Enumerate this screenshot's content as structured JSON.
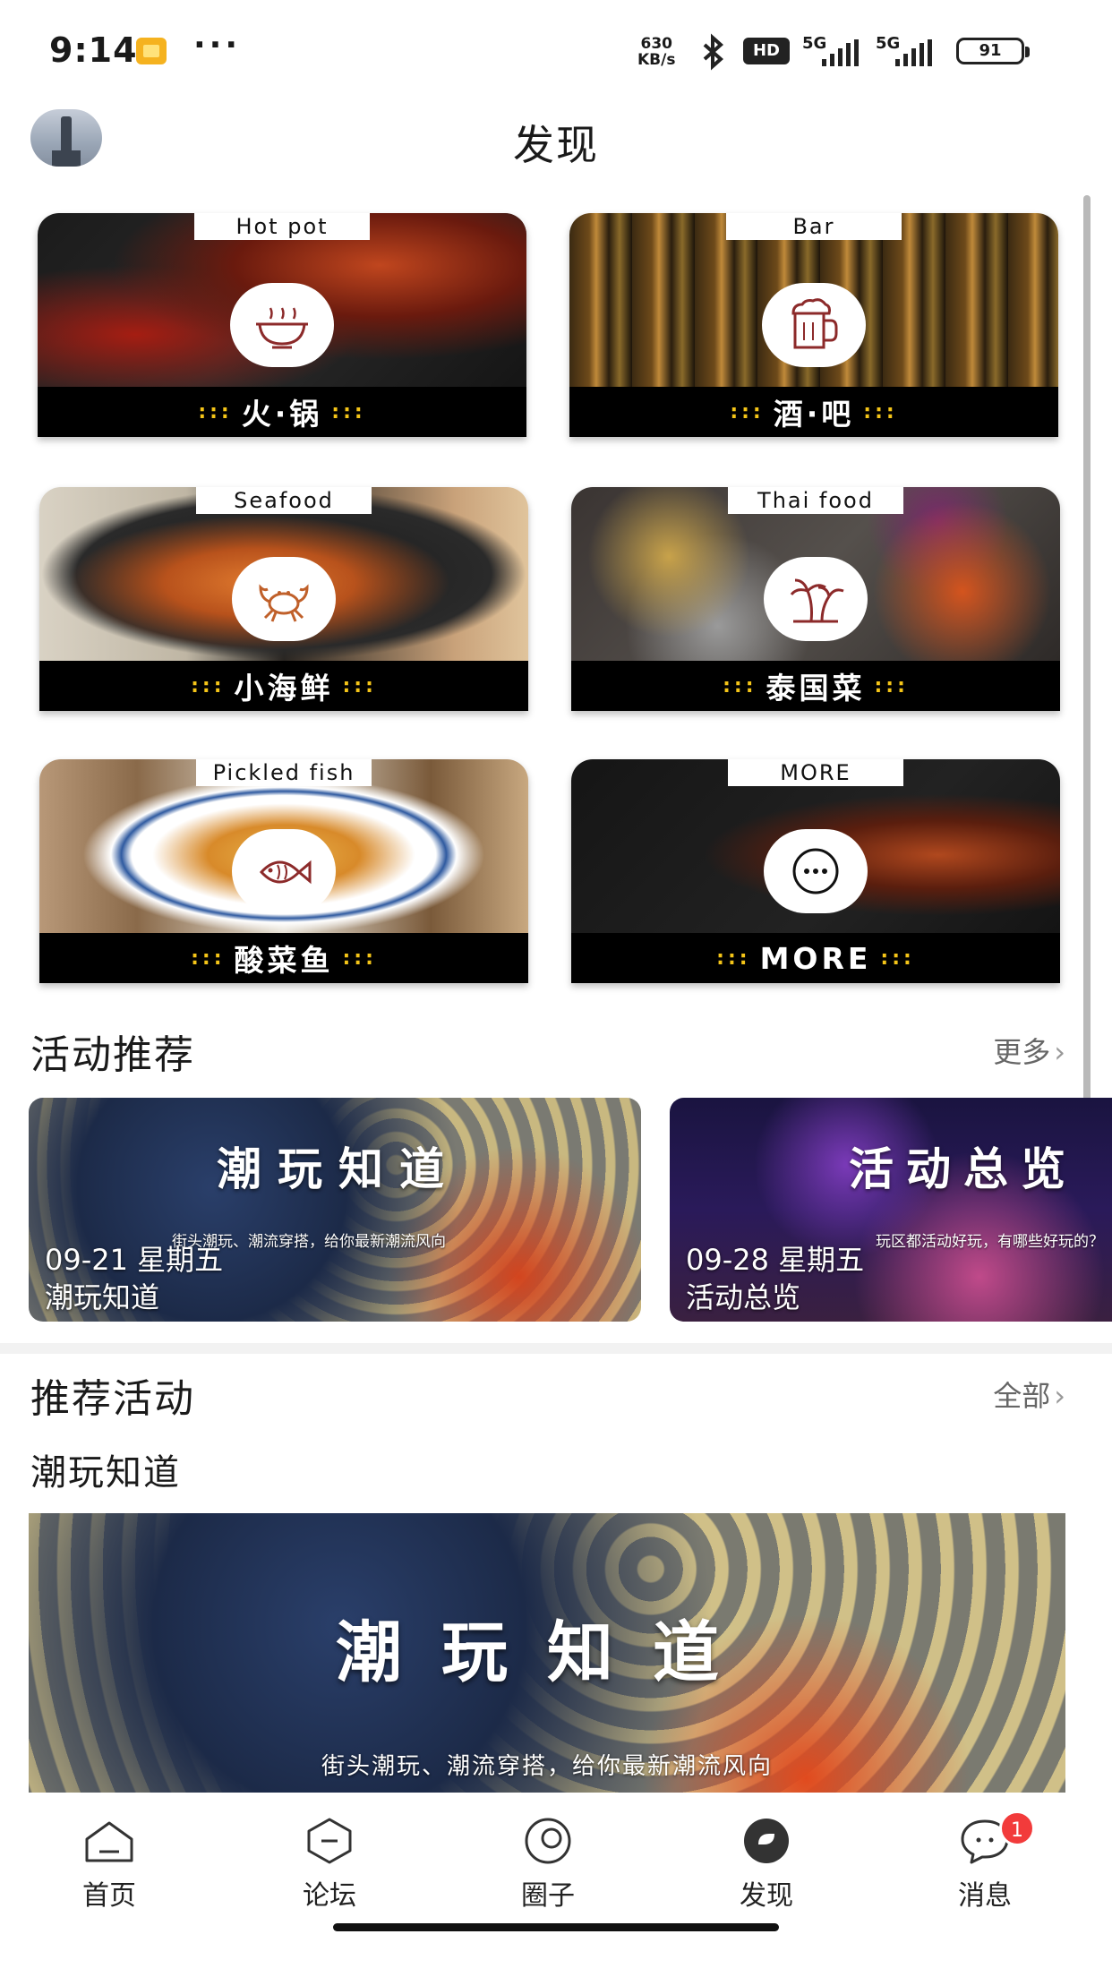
{
  "status_bar": {
    "time": "9:14",
    "dots": "···",
    "net_speed_value": "630",
    "net_speed_unit": "KB/s",
    "hd_label": "HD",
    "sig1_label": "5G",
    "sig2_label": "5G",
    "battery": "91"
  },
  "header": {
    "title": "发现"
  },
  "categories": [
    {
      "tag": "Hot pot",
      "label": "火·锅",
      "icon": "hotpot-icon"
    },
    {
      "tag": "Bar",
      "label": "酒·吧",
      "icon": "beer-mug-icon"
    },
    {
      "tag": "Seafood",
      "label": "小海鲜",
      "icon": "crab-icon"
    },
    {
      "tag": "Thai food",
      "label": "泰国菜",
      "icon": "palm-tree-icon"
    },
    {
      "tag": "Pickled fish",
      "label": "酸菜鱼",
      "icon": "fish-icon"
    },
    {
      "tag": "MORE",
      "label": "MORE",
      "icon": "more-dots-icon"
    }
  ],
  "band_dots": ":::",
  "activity_section": {
    "title": "活动推荐",
    "more_label": "更多",
    "cards": [
      {
        "big_text": "潮玩知道",
        "sub_text": "街头潮玩、潮流穿搭，给你最新潮流风向",
        "date": "09-21 星期五",
        "name": "潮玩知道"
      },
      {
        "big_text": "活动总览",
        "sub_text": "玩区都活动好玩，有哪些好玩的？",
        "date": "09-28 星期五",
        "name": "活动总览"
      }
    ]
  },
  "recommend_section": {
    "title": "推荐活动",
    "more_label": "全部",
    "sub_title": "潮玩知道",
    "banner_big": "潮玩知道",
    "banner_sub": "街头潮玩、潮流穿搭，给你最新潮流风向"
  },
  "bottom_nav": [
    {
      "label": "首页",
      "icon": "home-icon",
      "active": false
    },
    {
      "label": "论坛",
      "icon": "forum-icon",
      "active": false
    },
    {
      "label": "圈子",
      "icon": "circle-icon",
      "active": false
    },
    {
      "label": "发现",
      "icon": "discover-icon",
      "active": true
    },
    {
      "label": "消息",
      "icon": "message-icon",
      "active": false,
      "badge": "1"
    }
  ],
  "colors": {
    "accent_dots": "#f5c518",
    "badge": "#f23b3b",
    "band": "#000000"
  }
}
